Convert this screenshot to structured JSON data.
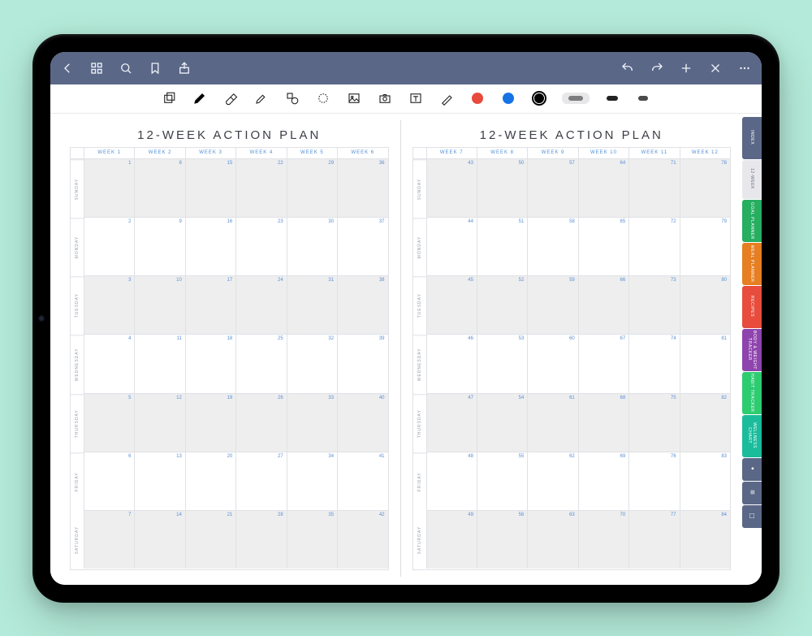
{
  "planner": {
    "title": "12-WEEK ACTION PLAN",
    "days": [
      "SUNDAY",
      "MONDAY",
      "TUESDAY",
      "WEDNESDAY",
      "THURSDAY",
      "FRIDAY",
      "SATURDAY"
    ],
    "left": {
      "weeks": [
        "WEEK 1",
        "WEEK 2",
        "WEEK 3",
        "WEEK 4",
        "WEEK 5",
        "WEEK 6"
      ],
      "rows": [
        [
          1,
          8,
          15,
          22,
          29,
          36
        ],
        [
          2,
          9,
          16,
          23,
          30,
          37
        ],
        [
          3,
          10,
          17,
          24,
          31,
          38
        ],
        [
          4,
          11,
          18,
          25,
          32,
          39
        ],
        [
          5,
          12,
          19,
          26,
          33,
          40
        ],
        [
          6,
          13,
          20,
          27,
          34,
          41
        ],
        [
          7,
          14,
          21,
          28,
          35,
          42
        ]
      ]
    },
    "right": {
      "weeks": [
        "WEEK 7",
        "WEEK 8",
        "WEEK 9",
        "WEEK 10",
        "WEEK 11",
        "WEEK 12"
      ],
      "rows": [
        [
          43,
          50,
          57,
          64,
          71,
          78
        ],
        [
          44,
          51,
          58,
          65,
          72,
          79
        ],
        [
          45,
          52,
          59,
          66,
          73,
          80
        ],
        [
          46,
          53,
          60,
          67,
          74,
          81
        ],
        [
          47,
          54,
          61,
          68,
          75,
          82
        ],
        [
          48,
          55,
          62,
          69,
          76,
          83
        ],
        [
          49,
          56,
          63,
          70,
          77,
          84
        ]
      ]
    }
  },
  "toolbar": {
    "colors": {
      "red": "#e84a3c",
      "blue": "#1673e6",
      "black": "#000000"
    },
    "swatches": {
      "a": "#7d7d7f",
      "b": "#222222",
      "c": "#4a4a4c"
    }
  },
  "tabs": {
    "index": "INDEX",
    "week": "12-WEEK",
    "goal": "GOAL PLANNER",
    "meal": "MEAL PLANNER",
    "recipes": "RECIPES",
    "body": "BODY & WEIGHT TRACKER",
    "habit": "HABIT TRACKER",
    "wellness": "WELLNESS CHART",
    "dot": "•",
    "lines": "≡",
    "square": "□"
  }
}
